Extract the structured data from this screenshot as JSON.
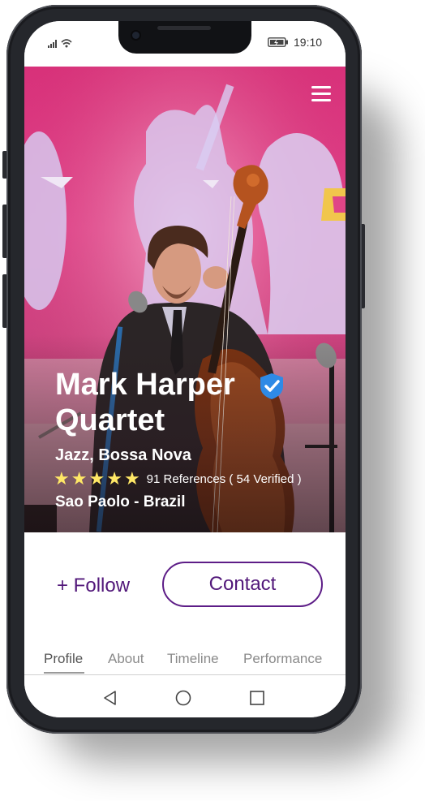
{
  "status_bar": {
    "time": "19:10"
  },
  "hero": {
    "artist_name_line1": "Mark Harper",
    "artist_name_line2": "Quartet",
    "genres": "Jazz, Bossa Nova",
    "rating": {
      "stars": 5,
      "max": 5
    },
    "references_text": "91 References ( 54 Verified )",
    "location": "Sao Paolo - Brazil",
    "star_color": "#ffe866",
    "verified_color": "#2e8ae6"
  },
  "actions": {
    "follow_label": "+ Follow",
    "contact_label": "Contact",
    "accent_color": "#52187a"
  },
  "tabs": [
    {
      "label": "Profile",
      "active": true
    },
    {
      "label": "About",
      "active": false
    },
    {
      "label": "Timeline",
      "active": false
    },
    {
      "label": "Performance",
      "active": false
    }
  ],
  "nav_bar": {
    "icons": [
      "back-icon",
      "home-icon",
      "recents-icon"
    ]
  }
}
